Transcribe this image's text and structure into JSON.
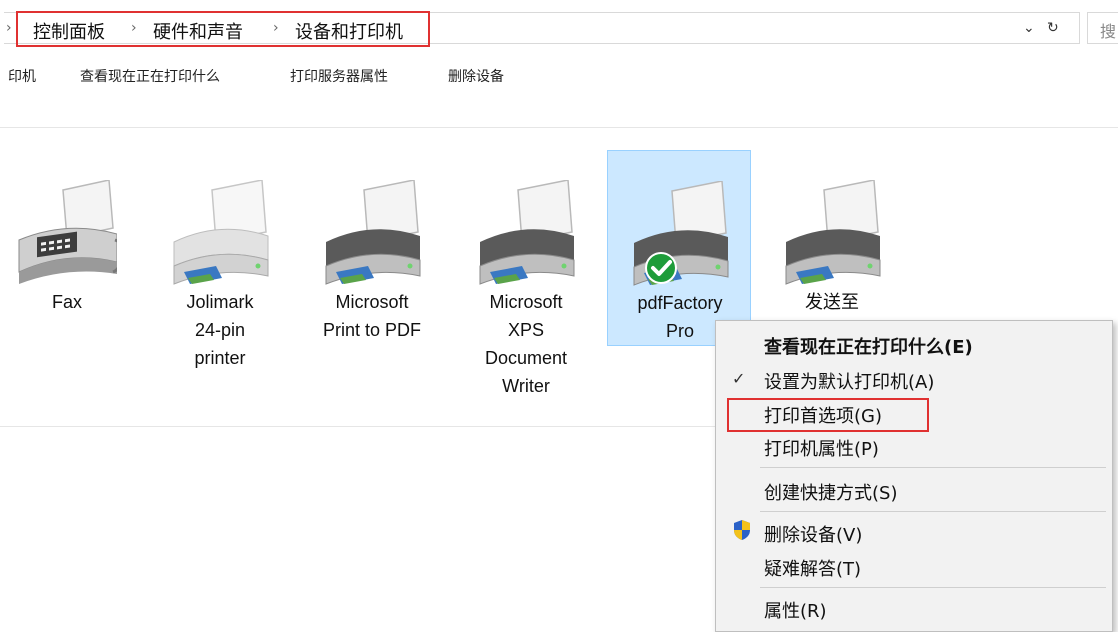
{
  "address_bar": {
    "breadcrumb": [
      "控制面板",
      "硬件和声音",
      "设备和打印机"
    ],
    "search_char": "搜"
  },
  "toolbar": {
    "items": [
      "印机",
      "查看现在正在打印什么",
      "打印服务器属性",
      "删除设备"
    ]
  },
  "devices": [
    {
      "label_lines": [
        "Fax"
      ],
      "icon": "fax-icon"
    },
    {
      "label_lines": [
        "Jolimark",
        "24-pin",
        "printer"
      ],
      "icon": "printer-icon"
    },
    {
      "label_lines": [
        "Microsoft",
        "Print to PDF"
      ],
      "icon": "printer-icon"
    },
    {
      "label_lines": [
        "Microsoft",
        "XPS",
        "Document",
        "Writer"
      ],
      "icon": "printer-icon"
    },
    {
      "label_lines": [
        "pdfFactory",
        "Pro"
      ],
      "icon": "printer-icon",
      "selected": true,
      "default_badge": "check-badge-icon"
    },
    {
      "label_lines": [
        "发送至"
      ],
      "icon": "printer-icon"
    }
  ],
  "context_menu": {
    "items": [
      {
        "label": "查看现在正在打印什么(E)",
        "bold": true
      },
      {
        "label": "设置为默认打印机(A)",
        "checked": true
      },
      {
        "label": "打印首选项(G)",
        "highlighted": true
      },
      {
        "label": "打印机属性(P)"
      },
      {
        "label": "创建快捷方式(S)"
      },
      {
        "label": "删除设备(V)",
        "icon": "uac-shield-icon"
      },
      {
        "label": "疑难解答(T)"
      },
      {
        "label": "属性(R)"
      }
    ]
  },
  "colors": {
    "selection": "#cce8ff",
    "highlight_border": "#e03131",
    "menu_bg": "#f2f2f2"
  }
}
